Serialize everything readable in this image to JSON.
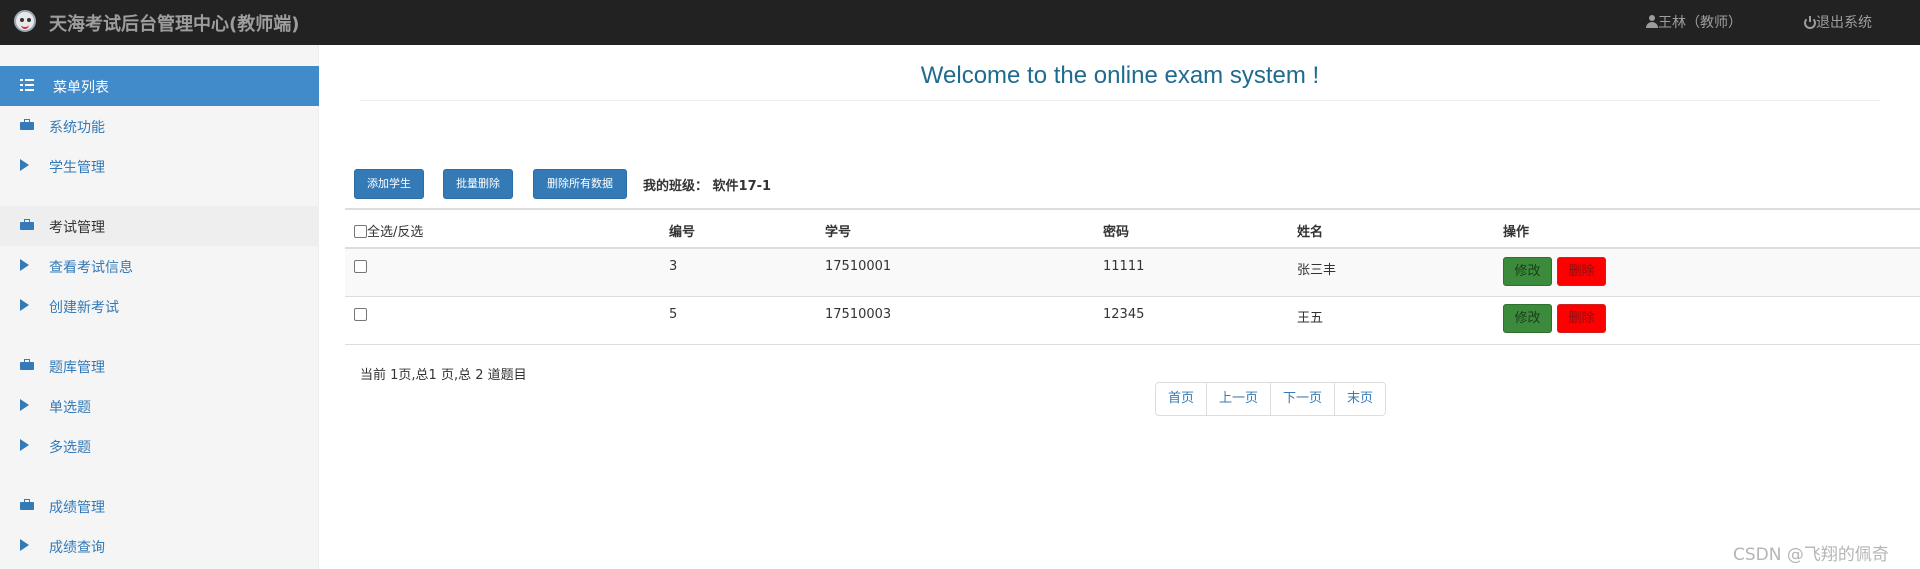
{
  "header": {
    "title": "天海考试后台管理中心(教师端)",
    "user": "王林（教师）",
    "logout": "退出系统"
  },
  "sidebar": {
    "menu_title": "菜单列表",
    "items": [
      {
        "label": "系统功能",
        "icon": "briefcase-icon",
        "type": "group"
      },
      {
        "label": "学生管理",
        "icon": "play-icon",
        "type": "link"
      },
      {
        "label": "考试管理",
        "icon": "briefcase-icon",
        "type": "group"
      },
      {
        "label": "查看考试信息",
        "icon": "play-icon",
        "type": "link"
      },
      {
        "label": "创建新考试",
        "icon": "play-icon",
        "type": "link"
      },
      {
        "label": "题库管理",
        "icon": "briefcase-icon",
        "type": "group"
      },
      {
        "label": "单选题",
        "icon": "play-icon",
        "type": "link"
      },
      {
        "label": "多选题",
        "icon": "play-icon",
        "type": "link"
      },
      {
        "label": "成绩管理",
        "icon": "briefcase-icon",
        "type": "group"
      },
      {
        "label": "成绩查询",
        "icon": "play-icon",
        "type": "link"
      }
    ]
  },
  "main": {
    "welcome": "Welcome to the online exam system !",
    "toolbar": {
      "add_student": "添加学生",
      "batch_delete": "批量删除",
      "delete_all": "删除所有数据",
      "class_label": "我的班级：  软件17-1"
    },
    "table": {
      "headers": {
        "select": "全选/反选",
        "id": "编号",
        "student_no": "学号",
        "password": "密码",
        "name": "姓名",
        "actions": "操作"
      },
      "rows": [
        {
          "id": "3",
          "student_no": "17510001",
          "password": "11111",
          "name": "张三丰",
          "edit": "修改",
          "delete": "删除"
        },
        {
          "id": "5",
          "student_no": "17510003",
          "password": "12345",
          "name": "王五",
          "edit": "修改",
          "delete": "删除"
        }
      ]
    },
    "page_info": "当前 1页,总1 页,总 2 道题目",
    "pager": {
      "first": "首页",
      "prev": "上一页",
      "next": "下一页",
      "last": "末页"
    }
  },
  "watermark": "CSDN @飞翔的佩奇",
  "colors": {
    "topbar": "#222222",
    "primary": "#337ab7",
    "sidebar_active": "#428bca",
    "edit_button": "#3c8b3c",
    "delete_button": "#ff0000",
    "welcome_text": "#1f6b8f"
  }
}
